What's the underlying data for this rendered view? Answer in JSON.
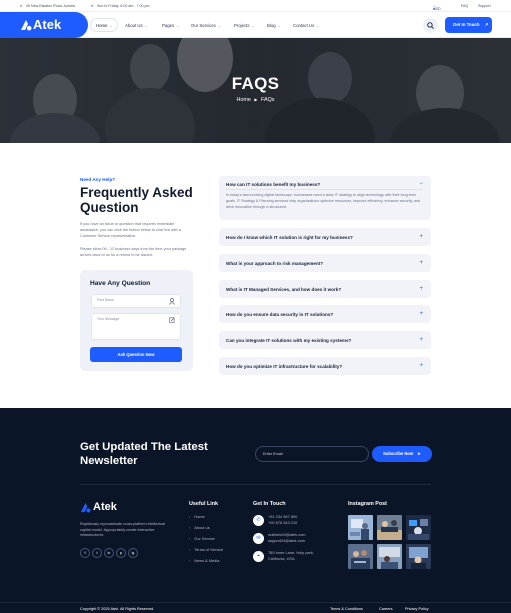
{
  "topbar": {
    "address": "45 New Eskaton Road, Austria",
    "hours": "Sun to Friday: 8.00 am - 7.00 pm",
    "currency": "USD",
    "faq": "FAQ",
    "support": "Support"
  },
  "header": {
    "logo": "Atek",
    "nav": [
      {
        "label": "Home",
        "has_dropdown": true
      },
      {
        "label": "About Us",
        "has_dropdown": true
      },
      {
        "label": "Pages",
        "has_dropdown": true
      },
      {
        "label": "Our Services",
        "has_dropdown": true
      },
      {
        "label": "Projects",
        "has_dropdown": true
      },
      {
        "label": "Blog",
        "has_dropdown": true
      },
      {
        "label": "Contact Us",
        "has_dropdown": true
      }
    ],
    "cta": "Get In Touch",
    "chevron": "⌄"
  },
  "hero": {
    "title": "FAQS",
    "crumb_home": "Home",
    "crumb_sep": "▶",
    "crumb_current": "FAQs"
  },
  "intro": {
    "eyebrow": "Need Any Help?",
    "heading": "Frequently Asked Question",
    "para1": "If you have an issue or question that requires immediate assistance, you can click the button below to chat live with a Customer Service representative.",
    "para2": "Please allow 06 - 12 business days from the time your package arrives back to us for a refund to be issued."
  },
  "question_form": {
    "title": "Have Any Question",
    "name_placeholder": "First Name",
    "message_placeholder": "Your Message",
    "submit": "Ask Question Now"
  },
  "faqs": [
    {
      "question": "How can IT solutions benefit my business?",
      "answer": "In today's fast-evolving digital landscape, businesses need a clear IT strategy to align technology with their long-term goals. IT Strategy & Planning services help organizations optimize resources, improve efficiency, enhance security, and drive innovation through a structured.",
      "open": true
    },
    {
      "question": "How do I know which IT solution is right for my business?",
      "open": false
    },
    {
      "question": "What is your approach to risk management?",
      "open": false
    },
    {
      "question": "What is IT Managed Services, and how does it work?",
      "open": false
    },
    {
      "question": "How do you ensure data security in IT solutions?",
      "open": false
    },
    {
      "question": "Can you integrate IT solutions with my existing systems?",
      "open": false
    },
    {
      "question": "How do you optimize IT infrastructure for scalability?",
      "open": false
    }
  ],
  "faq_icons": {
    "open": "−",
    "closed": "+"
  },
  "newsletter": {
    "title": "Get Updated The Latest Newsletter",
    "email_placeholder": "Enter Email",
    "button": "Subscribe Now"
  },
  "footer": {
    "logo": "Atek",
    "about": "Rapidiously myocardinate cross-platform intellectual capital model. Appropriately create interactive infrastructures",
    "social": [
      "f",
      "t",
      "in",
      "p",
      "ig"
    ],
    "useful_title": "Useful Link",
    "useful_links": [
      "Home",
      "About us",
      "Our Service",
      "Terms of Service",
      "News & Media"
    ],
    "touch_title": "Get In Touch",
    "phones": [
      "+91 234 567 890",
      "+00 876 543 210"
    ],
    "emails": [
      "mailinfo00@atek.com",
      "support24@atek.com"
    ],
    "address": [
      "789 Inner Lane, Holy park,",
      "California, USA"
    ],
    "insta_title": "Instagram Post",
    "copyright": "Copyright © 2025 Atek. All Rights Reserved.",
    "bottom_links": [
      "Terms & Conditions",
      "Careers",
      "Privacy Policy"
    ]
  },
  "colors": {
    "accent": "#1f5cff",
    "dark": "#0b1528",
    "faq_bg": "#f1f3f9"
  }
}
